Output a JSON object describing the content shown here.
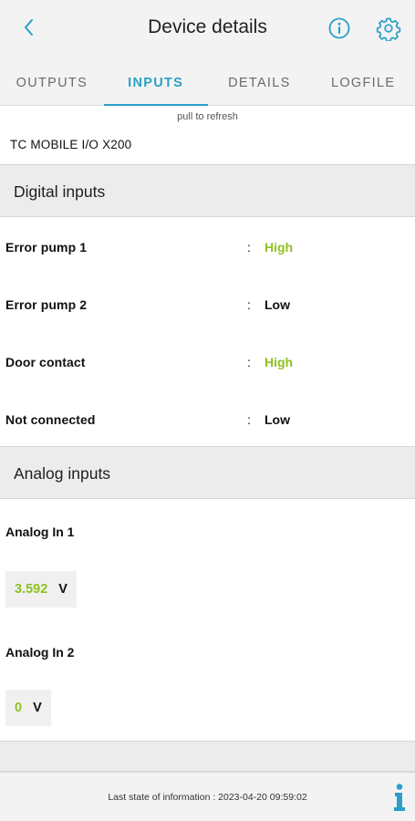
{
  "header": {
    "title": "Device details",
    "back_icon": "chevron-left-icon",
    "info_icon": "info-circle-icon",
    "settings_icon": "gear-icon",
    "accent_color": "#2aa0c8"
  },
  "tabs": [
    {
      "label": "OUTPUTS",
      "active": false
    },
    {
      "label": "INPUTS",
      "active": true
    },
    {
      "label": "DETAILS",
      "active": false
    },
    {
      "label": "LOGFILE",
      "active": false
    }
  ],
  "refresh_hint": "pull to refresh",
  "device_name": "TC MOBILE I/O X200",
  "digital_inputs": {
    "title": "Digital inputs",
    "separator": ":",
    "high_color": "#8dc21f",
    "items": [
      {
        "label": "Error pump 1",
        "value": "High"
      },
      {
        "label": "Error pump 2",
        "value": "Low"
      },
      {
        "label": "Door contact",
        "value": "High"
      },
      {
        "label": "Not connected",
        "value": "Low"
      }
    ]
  },
  "analog_inputs": {
    "title": "Analog inputs",
    "items": [
      {
        "label": "Analog In 1",
        "value": "3.592",
        "unit": "V"
      },
      {
        "label": "Analog In 2",
        "value": "0",
        "unit": "V"
      }
    ]
  },
  "footer": {
    "status": "Last state of information : 2023-04-20 09:59:02",
    "info_icon": "info-icon"
  }
}
